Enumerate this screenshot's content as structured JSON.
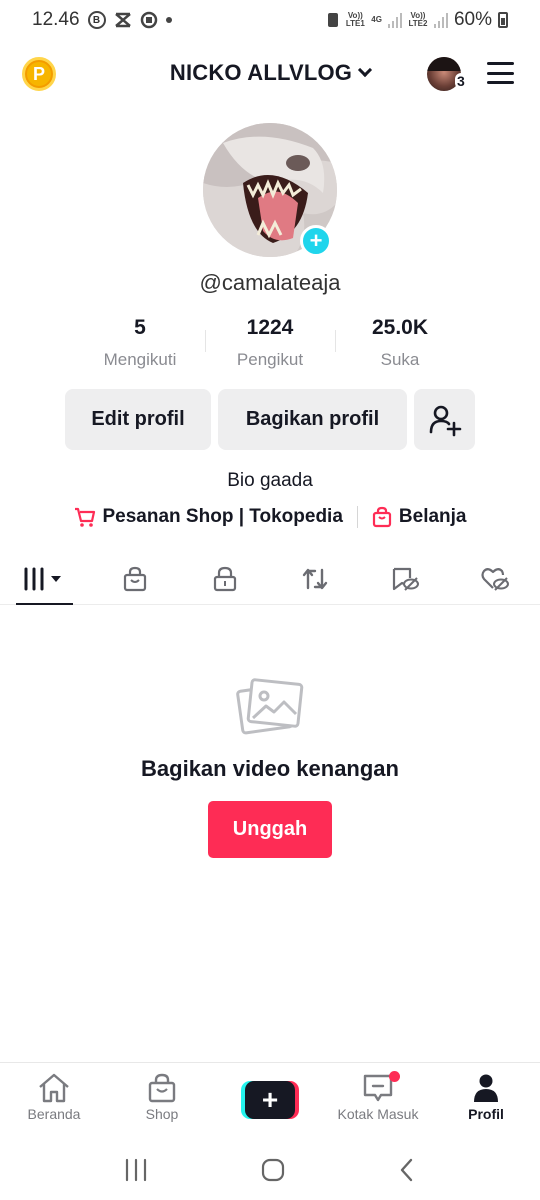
{
  "status_bar": {
    "time": "12.46",
    "net_vo1": "Vo)) LTE1",
    "net_4g": "4G",
    "net_vo2": "Vo)) LTE2",
    "battery": "60%",
    "icons": [
      "b-circle-icon",
      "capcut-icon",
      "chat-icon",
      "dot-icon"
    ]
  },
  "header": {
    "coin_label": "P",
    "username": "NICKO ALLVLOG",
    "account_count": "3"
  },
  "profile": {
    "handle": "@camalateaja",
    "stats": [
      {
        "value": "5",
        "label": "Mengikuti"
      },
      {
        "value": "1224",
        "label": "Pengikut"
      },
      {
        "value": "25.0K",
        "label": "Suka"
      }
    ],
    "edit_label": "Edit profil",
    "share_label": "Bagikan profil",
    "bio": "Bio gaada",
    "links": {
      "shop": "Pesanan Shop | Tokopedia",
      "cart": "Belanja"
    }
  },
  "tabs": [
    "videos-grid-icon",
    "shop-bag-icon",
    "lock-icon",
    "repost-icon",
    "hidden-posts-icon",
    "hidden-likes-icon"
  ],
  "empty_state": {
    "title": "Bagikan video kenangan",
    "button": "Unggah"
  },
  "bottom_nav": {
    "home": "Beranda",
    "shop": "Shop",
    "inbox": "Kotak Masuk",
    "profile": "Profil"
  },
  "colors": {
    "accent": "#fe2c55",
    "cyan": "#25f4ee",
    "badge": "#20d5ec",
    "text": "#161823",
    "muted": "#8a8b91"
  }
}
